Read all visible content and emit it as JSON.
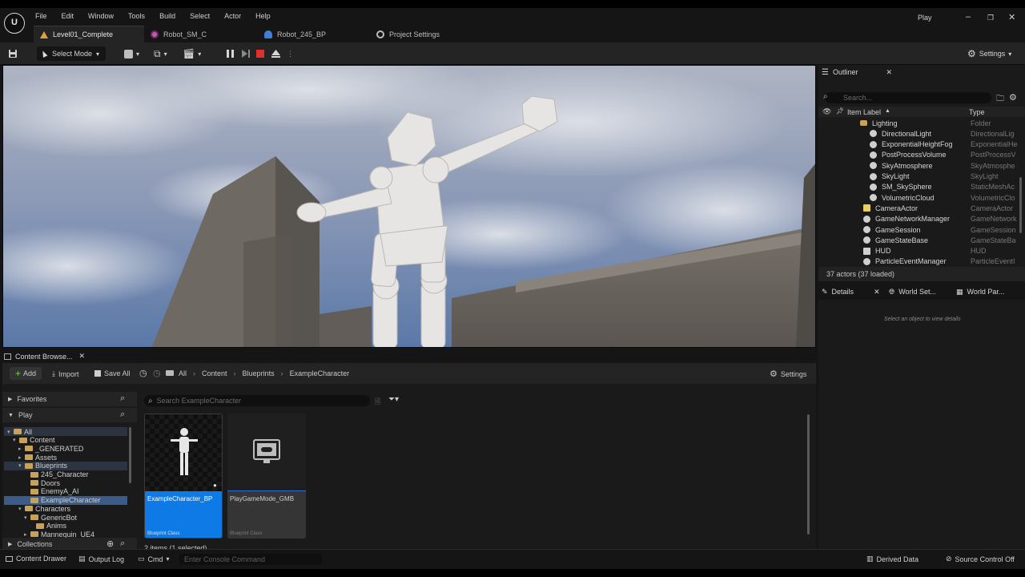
{
  "app": {
    "logo_text": "U",
    "menu": [
      "File",
      "Edit",
      "Window",
      "Tools",
      "Build",
      "Select",
      "Actor",
      "Help"
    ],
    "mode_label": "Play"
  },
  "tabs": [
    {
      "label": "Level01_Complete"
    },
    {
      "label": "Robot_SM_C"
    },
    {
      "label": "Robot_245_BP"
    },
    {
      "label": "Project Settings"
    }
  ],
  "toolbar": {
    "select_mode": "Select Mode",
    "settings": "Settings"
  },
  "outliner": {
    "title": "Outliner",
    "search_placeholder": "Search...",
    "col_label": "Item Label",
    "col_type": "Type",
    "rows": [
      {
        "label": "Lighting",
        "type": "Folder",
        "indent": 2
      },
      {
        "label": "DirectionalLight",
        "type": "DirectionalLig",
        "indent": 3
      },
      {
        "label": "ExponentialHeightFog",
        "type": "ExponentialHe",
        "indent": 3
      },
      {
        "label": "PostProcessVolume",
        "type": "PostProcessV",
        "indent": 3
      },
      {
        "label": "SkyAtmosphere",
        "type": "SkyAtmosphe",
        "indent": 3
      },
      {
        "label": "SkyLight",
        "type": "SkyLight",
        "indent": 3
      },
      {
        "label": "SM_SkySphere",
        "type": "StaticMeshAc",
        "indent": 3
      },
      {
        "label": "VolumetricCloud",
        "type": "VolumetricClo",
        "indent": 3
      },
      {
        "label": "CameraActor",
        "type": "CameraActor",
        "indent": 2
      },
      {
        "label": "GameNetworkManager",
        "type": "GameNetwork",
        "indent": 2
      },
      {
        "label": "GameSession",
        "type": "GameSession",
        "indent": 2
      },
      {
        "label": "GameStateBase",
        "type": "GameStateBa",
        "indent": 2
      },
      {
        "label": "HUD",
        "type": "HUD",
        "indent": 2
      },
      {
        "label": "ParticleEventManager",
        "type": "ParticleEventI",
        "indent": 2
      }
    ],
    "actor_count": "37 actors (37 loaded)"
  },
  "details": {
    "tabs": [
      "Details",
      "World Set...",
      "World Par..."
    ],
    "empty_msg": "Select an object to view details"
  },
  "content_browser": {
    "title": "Content Browse...",
    "add": "Add",
    "import": "Import",
    "save_all": "Save All",
    "breadcrumb": [
      "All",
      "Content",
      "Blueprints",
      "ExampleCharacter"
    ],
    "settings": "Settings",
    "favorites": "Favorites",
    "play": "Play",
    "search_placeholder": "Search ExampleCharacter",
    "tree": [
      {
        "label": "All",
        "depth": 0,
        "arrow": "▾"
      },
      {
        "label": "Content",
        "depth": 1,
        "arrow": "▾"
      },
      {
        "label": "_GENERATED",
        "depth": 2,
        "arrow": "▸"
      },
      {
        "label": "Assets",
        "depth": 2,
        "arrow": "▸"
      },
      {
        "label": "Blueprints",
        "depth": 2,
        "arrow": "▾"
      },
      {
        "label": "245_Character",
        "depth": 3,
        "arrow": ""
      },
      {
        "label": "Doors",
        "depth": 3,
        "arrow": ""
      },
      {
        "label": "EnemyA_AI",
        "depth": 3,
        "arrow": ""
      },
      {
        "label": "ExampleCharacter",
        "depth": 3,
        "arrow": ""
      },
      {
        "label": "Characters",
        "depth": 2,
        "arrow": "▾"
      },
      {
        "label": "GenericBot",
        "depth": 3,
        "arrow": "▾"
      },
      {
        "label": "Anims",
        "depth": 4,
        "arrow": ""
      },
      {
        "label": "Mannequin_UE4",
        "depth": 3,
        "arrow": "▸"
      }
    ],
    "collections": "Collections",
    "assets": [
      {
        "name": "ExampleCharacter_BP",
        "class": "Blueprint Class"
      },
      {
        "name": "PlayGameMode_GMB",
        "class": "Blueprint Class"
      }
    ],
    "item_count": "2 items (1 selected)"
  },
  "status": {
    "content_drawer": "Content Drawer",
    "output_log": "Output Log",
    "cmd": "Cmd",
    "console_placeholder": "Enter Console Command",
    "derived_data": "Derived Data",
    "source_control": "Source Control Off"
  }
}
